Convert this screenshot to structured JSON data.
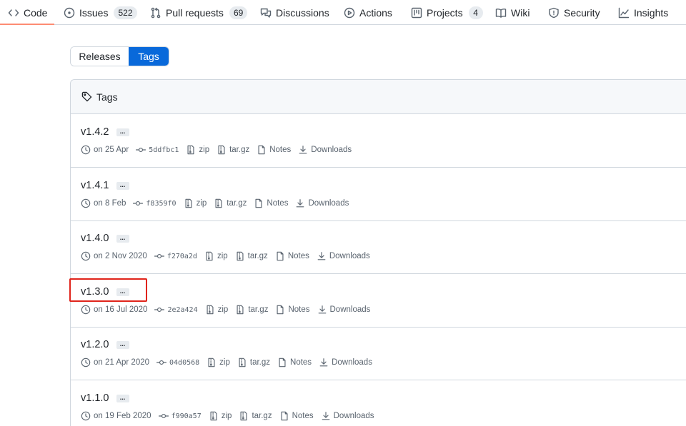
{
  "nav": {
    "items": [
      {
        "label": "Code",
        "icon": "code-icon"
      },
      {
        "label": "Issues",
        "icon": "issue-icon",
        "count": "522"
      },
      {
        "label": "Pull requests",
        "icon": "pull-request-icon",
        "count": "69"
      },
      {
        "label": "Discussions",
        "icon": "discussions-icon"
      },
      {
        "label": "Actions",
        "icon": "actions-icon"
      },
      {
        "label": "Projects",
        "icon": "projects-icon",
        "count": "4"
      },
      {
        "label": "Wiki",
        "icon": "wiki-icon"
      },
      {
        "label": "Security",
        "icon": "security-icon"
      },
      {
        "label": "Insights",
        "icon": "insights-icon"
      }
    ],
    "active": "Code"
  },
  "toggle": {
    "releases_label": "Releases",
    "tags_label": "Tags",
    "selected": "Tags"
  },
  "box": {
    "header_title": "Tags"
  },
  "tags": [
    {
      "name": "v1.4.2",
      "date": "on 25 Apr",
      "sha": "5ddfbc1",
      "zip": "zip",
      "targz": "tar.gz",
      "notes": "Notes",
      "downloads": "Downloads"
    },
    {
      "name": "v1.4.1",
      "date": "on 8 Feb",
      "sha": "f8359f0",
      "zip": "zip",
      "targz": "tar.gz",
      "notes": "Notes",
      "downloads": "Downloads"
    },
    {
      "name": "v1.4.0",
      "date": "on 2 Nov 2020",
      "sha": "f270a2d",
      "zip": "zip",
      "targz": "tar.gz",
      "notes": "Notes",
      "downloads": "Downloads"
    },
    {
      "name": "v1.3.0",
      "date": "on 16 Jul 2020",
      "sha": "2e2a424",
      "zip": "zip",
      "targz": "tar.gz",
      "notes": "Notes",
      "downloads": "Downloads"
    },
    {
      "name": "v1.2.0",
      "date": "on 21 Apr 2020",
      "sha": "04d0568",
      "zip": "zip",
      "targz": "tar.gz",
      "notes": "Notes",
      "downloads": "Downloads"
    },
    {
      "name": "v1.1.0",
      "date": "on 19 Feb 2020",
      "sha": "f990a57",
      "zip": "zip",
      "targz": "tar.gz",
      "notes": "Notes",
      "downloads": "Downloads"
    }
  ],
  "ellipsis_label": "...",
  "colors": {
    "accent": "#0969da",
    "nav_underline": "#fd8c73",
    "highlight": "#e0241b",
    "border": "#d0d7de",
    "muted": "#59636e"
  }
}
